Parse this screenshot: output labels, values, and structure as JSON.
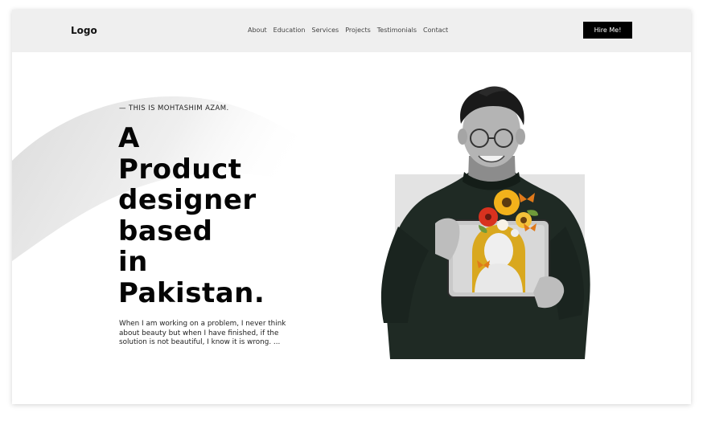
{
  "header": {
    "logo": "Logo",
    "nav": [
      "About",
      "Education",
      "Services",
      "Projects",
      "Testimonials",
      "Contact"
    ],
    "cta": "Hire Me!"
  },
  "hero": {
    "kicker": "— THIS IS MOHTASHIM AZAM.",
    "headline_lines": [
      "A",
      "Product",
      "designer",
      "based",
      "in",
      "Pakistan."
    ],
    "description": "When I am working on a problem, I never think about beauty but when I have finished, if the solution is not beautiful, I know it is wrong. ..."
  },
  "colors": {
    "topbar_bg": "#efefef",
    "button_bg": "#000000",
    "photo_frame_bg": "#e3e3e3",
    "sweater": "#1f2a24"
  }
}
